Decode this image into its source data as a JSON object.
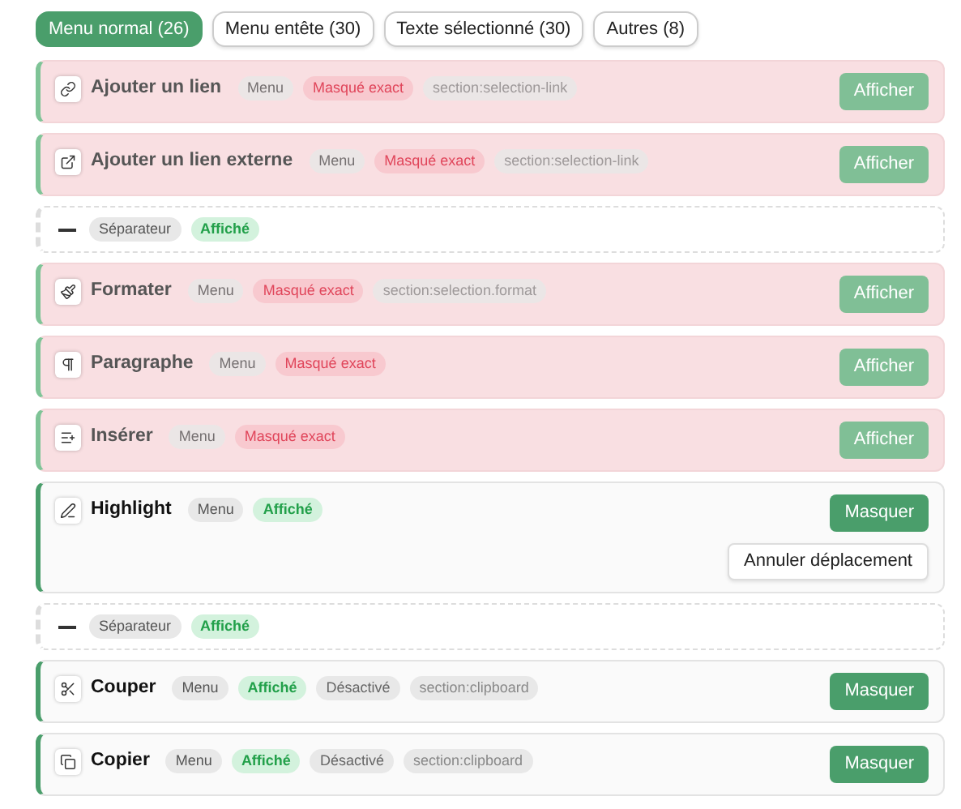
{
  "tabs": [
    {
      "label": "Menu normal (26)",
      "selected": true
    },
    {
      "label": "Menu entête (30)",
      "selected": false
    },
    {
      "label": "Texte sélectionné (30)",
      "selected": false
    },
    {
      "label": "Autres (8)",
      "selected": false
    }
  ],
  "items": [
    {
      "kind": "item",
      "title": "Ajouter un lien",
      "hidden": true,
      "badges": [
        {
          "kind": "type",
          "text": "Menu"
        },
        {
          "kind": "hidden",
          "text": "Masqué exact"
        },
        {
          "kind": "section",
          "text": "section:selection-link"
        }
      ],
      "button": "Afficher"
    },
    {
      "kind": "item",
      "title": "Ajouter un lien externe",
      "hidden": true,
      "badges": [
        {
          "kind": "type",
          "text": "Menu"
        },
        {
          "kind": "hidden",
          "text": "Masqué exact"
        },
        {
          "kind": "section",
          "text": "section:selection-link"
        }
      ],
      "button": "Afficher"
    },
    {
      "kind": "separator",
      "badges": [
        {
          "kind": "type",
          "text": "Séparateur"
        },
        {
          "kind": "shown",
          "text": "Affiché"
        }
      ]
    },
    {
      "kind": "item",
      "title": "Formater",
      "hidden": true,
      "badges": [
        {
          "kind": "type",
          "text": "Menu"
        },
        {
          "kind": "hidden",
          "text": "Masqué exact"
        },
        {
          "kind": "section",
          "text": "section:selection.format"
        }
      ],
      "button": "Afficher"
    },
    {
      "kind": "item",
      "title": "Paragraphe",
      "hidden": true,
      "badges": [
        {
          "kind": "type",
          "text": "Menu"
        },
        {
          "kind": "hidden",
          "text": "Masqué exact"
        }
      ],
      "button": "Afficher"
    },
    {
      "kind": "item",
      "title": "Insérer",
      "hidden": true,
      "badges": [
        {
          "kind": "type",
          "text": "Menu"
        },
        {
          "kind": "hidden",
          "text": "Masqué exact"
        }
      ],
      "button": "Afficher"
    },
    {
      "kind": "item",
      "title": "Highlight",
      "hidden": false,
      "badges": [
        {
          "kind": "type",
          "text": "Menu"
        },
        {
          "kind": "shown",
          "text": "Affiché"
        }
      ],
      "button": "Masquer",
      "secondary_button": "Annuler déplacement"
    },
    {
      "kind": "separator",
      "badges": [
        {
          "kind": "type",
          "text": "Séparateur"
        },
        {
          "kind": "shown",
          "text": "Affiché"
        }
      ]
    },
    {
      "kind": "item",
      "title": "Couper",
      "hidden": false,
      "badges": [
        {
          "kind": "type",
          "text": "Menu"
        },
        {
          "kind": "shown",
          "text": "Affiché"
        },
        {
          "kind": "disabled",
          "text": "Désactivé"
        },
        {
          "kind": "section",
          "text": "section:clipboard"
        }
      ],
      "button": "Masquer"
    },
    {
      "kind": "item",
      "title": "Copier",
      "hidden": false,
      "badges": [
        {
          "kind": "type",
          "text": "Menu"
        },
        {
          "kind": "shown",
          "text": "Affiché"
        },
        {
          "kind": "disabled",
          "text": "Désactivé"
        },
        {
          "kind": "section",
          "text": "section:clipboard"
        }
      ],
      "button": "Masquer"
    }
  ]
}
